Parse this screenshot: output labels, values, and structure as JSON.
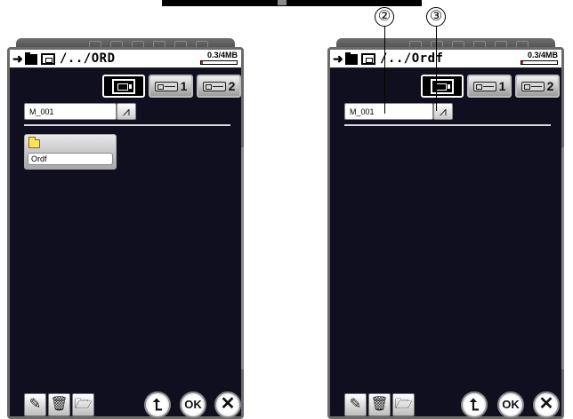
{
  "screens": [
    {
      "path": "/../ORD",
      "memory": "0.3/4MB",
      "memory_fraction": 0.05,
      "device_tabs": [
        "1",
        "2"
      ],
      "filename": "M_001",
      "folders": [
        {
          "name": "Ordf"
        }
      ]
    },
    {
      "path": "/../Ordf",
      "memory": "0.3/4MB",
      "memory_fraction": 0.05,
      "device_tabs": [
        "1",
        "2"
      ],
      "filename": "M_001",
      "folders": []
    }
  ],
  "buttons": {
    "ok_label": "OK",
    "up_glyph": "⮤",
    "close_glyph": "✕",
    "pencil_glyph": "✎",
    "trash_glyph": "🗑",
    "newfolder_glyph": "🗁",
    "keyboard_glyph": "⩘"
  },
  "callouts": [
    "②",
    "③"
  ],
  "icons": [
    "arrow-right-icon",
    "folder-icon",
    "machine-icon",
    "usb-icon",
    "keyboard-icon",
    "pencil-icon",
    "trash-icon",
    "new-folder-icon",
    "up-arrow-icon",
    "close-icon"
  ]
}
